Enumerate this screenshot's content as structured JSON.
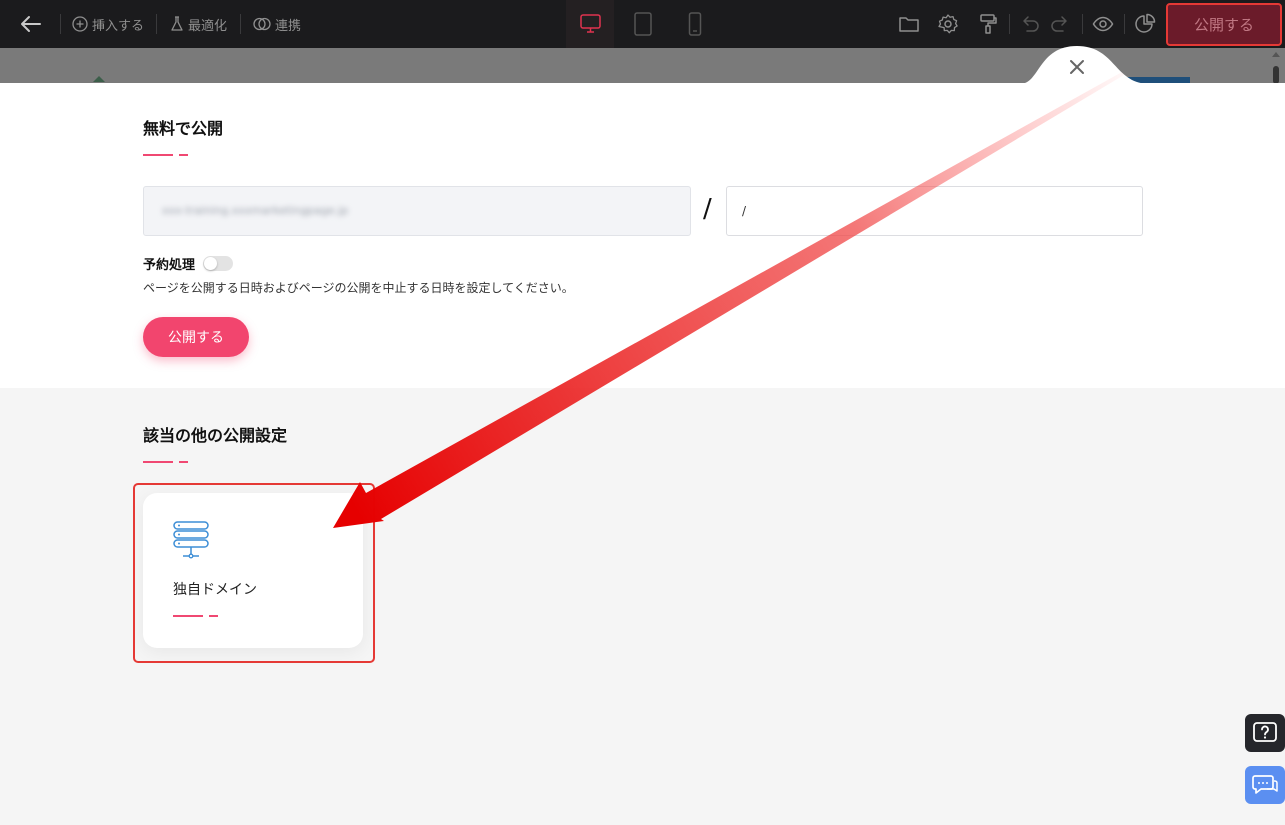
{
  "toolbar": {
    "insert_label": "挿入する",
    "optimize_label": "最適化",
    "link_label": "連携",
    "publish_label": "公開する"
  },
  "free_publish": {
    "title": "無料で公開",
    "domain_prefix_blurred": "xxx-training.xxxmarketingpage.jp",
    "path_value": "/",
    "schedule_label": "予約処理",
    "schedule_enabled": false,
    "schedule_description": "ページを公開する日時およびページの公開を中止する日時を設定してください。",
    "publish_button": "公開する"
  },
  "other_settings": {
    "title": "該当の他の公開設定",
    "cards": [
      {
        "label": "独自ドメイン",
        "icon": "server-icon"
      }
    ]
  },
  "colors": {
    "accent": "#f04872",
    "publish_button": "#f2456e",
    "annotation_red": "#e53935",
    "icon_blue": "#3d8ed6",
    "toolbar_bg": "#1b1b1d"
  }
}
